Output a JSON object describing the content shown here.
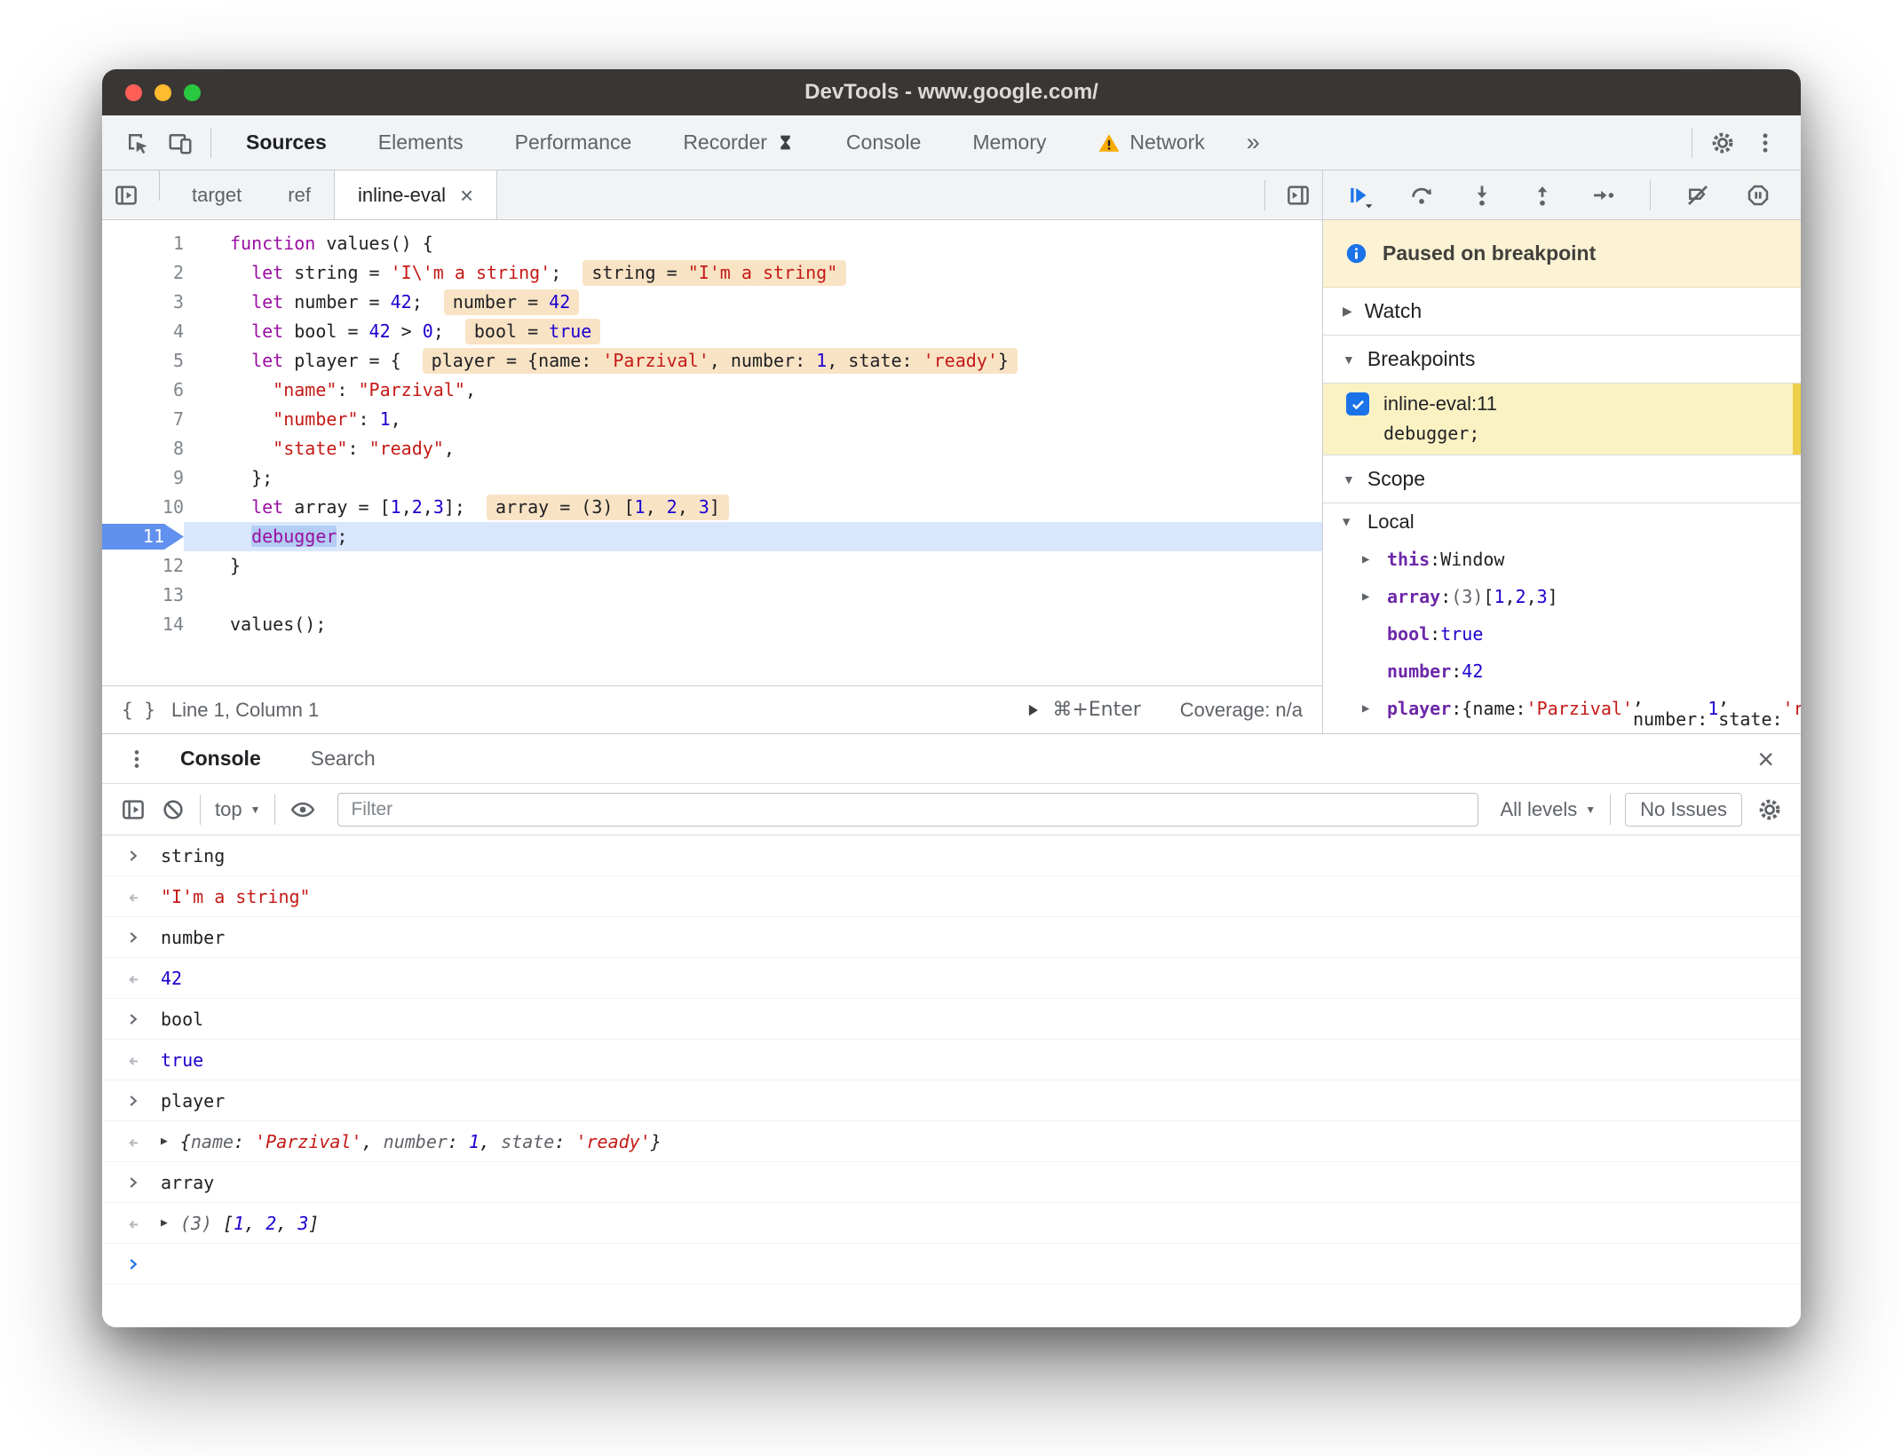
{
  "window": {
    "title": "DevTools - www.google.com/"
  },
  "toolbar": {
    "tabs": [
      {
        "label": "Sources",
        "active": true
      },
      {
        "label": "Elements"
      },
      {
        "label": "Performance"
      },
      {
        "label": "Recorder",
        "trailing_icon": "experiment-icon"
      },
      {
        "label": "Console"
      },
      {
        "label": "Memory"
      },
      {
        "label": "Network",
        "leading_icon": "warning-icon"
      }
    ],
    "overflow_label": "»"
  },
  "sources": {
    "file_tabs": [
      {
        "label": "target"
      },
      {
        "label": "ref"
      },
      {
        "label": "inline-eval",
        "active": true,
        "close_label": "×"
      }
    ],
    "status_bar": {
      "pretty_print_label": "{ }",
      "position": "Line 1, Column 1",
      "run_shortcut": "⌘+Enter",
      "coverage": "Coverage: n/a"
    },
    "lines": [
      {
        "n": 1,
        "code": [
          {
            "c": "k",
            "t": "function"
          },
          {
            "c": "p",
            "t": " values() {"
          }
        ]
      },
      {
        "n": 2,
        "code": [
          {
            "c": "p",
            "t": "  "
          },
          {
            "c": "k",
            "t": "let"
          },
          {
            "c": "p",
            "t": " string = "
          },
          {
            "c": "s",
            "t": "'I\\'m a string'"
          },
          {
            "c": "p",
            "t": ";"
          }
        ],
        "eval": [
          {
            "c": "p",
            "t": "string = "
          },
          {
            "c": "s",
            "t": "\"I'm a string\""
          }
        ]
      },
      {
        "n": 3,
        "code": [
          {
            "c": "p",
            "t": "  "
          },
          {
            "c": "k",
            "t": "let"
          },
          {
            "c": "p",
            "t": " number = "
          },
          {
            "c": "n",
            "t": "42"
          },
          {
            "c": "p",
            "t": ";"
          }
        ],
        "eval": [
          {
            "c": "p",
            "t": "number = "
          },
          {
            "c": "n",
            "t": "42"
          }
        ]
      },
      {
        "n": 4,
        "code": [
          {
            "c": "p",
            "t": "  "
          },
          {
            "c": "k",
            "t": "let"
          },
          {
            "c": "p",
            "t": " bool = "
          },
          {
            "c": "n",
            "t": "42"
          },
          {
            "c": "p",
            "t": " > "
          },
          {
            "c": "n",
            "t": "0"
          },
          {
            "c": "p",
            "t": ";"
          }
        ],
        "eval": [
          {
            "c": "p",
            "t": "bool = "
          },
          {
            "c": "n",
            "t": "true"
          }
        ]
      },
      {
        "n": 5,
        "code": [
          {
            "c": "p",
            "t": "  "
          },
          {
            "c": "k",
            "t": "let"
          },
          {
            "c": "p",
            "t": " player = {"
          }
        ],
        "eval": [
          {
            "c": "p",
            "t": "player = {name: "
          },
          {
            "c": "s",
            "t": "'Parzival'"
          },
          {
            "c": "p",
            "t": ", number: "
          },
          {
            "c": "n",
            "t": "1"
          },
          {
            "c": "p",
            "t": ", state: "
          },
          {
            "c": "s",
            "t": "'ready'"
          },
          {
            "c": "p",
            "t": "}"
          }
        ]
      },
      {
        "n": 6,
        "code": [
          {
            "c": "p",
            "t": "    "
          },
          {
            "c": "s",
            "t": "\"name\""
          },
          {
            "c": "p",
            "t": ": "
          },
          {
            "c": "s",
            "t": "\"Parzival\""
          },
          {
            "c": "p",
            "t": ","
          }
        ]
      },
      {
        "n": 7,
        "code": [
          {
            "c": "p",
            "t": "    "
          },
          {
            "c": "s",
            "t": "\"number\""
          },
          {
            "c": "p",
            "t": ": "
          },
          {
            "c": "n",
            "t": "1"
          },
          {
            "c": "p",
            "t": ","
          }
        ]
      },
      {
        "n": 8,
        "code": [
          {
            "c": "p",
            "t": "    "
          },
          {
            "c": "s",
            "t": "\"state\""
          },
          {
            "c": "p",
            "t": ": "
          },
          {
            "c": "s",
            "t": "\"ready\""
          },
          {
            "c": "p",
            "t": ","
          }
        ]
      },
      {
        "n": 9,
        "code": [
          {
            "c": "p",
            "t": "  };"
          }
        ]
      },
      {
        "n": 10,
        "code": [
          {
            "c": "p",
            "t": "  "
          },
          {
            "c": "k",
            "t": "let"
          },
          {
            "c": "p",
            "t": " array = ["
          },
          {
            "c": "n",
            "t": "1"
          },
          {
            "c": "p",
            "t": ","
          },
          {
            "c": "n",
            "t": "2"
          },
          {
            "c": "p",
            "t": ","
          },
          {
            "c": "n",
            "t": "3"
          },
          {
            "c": "p",
            "t": "];"
          }
        ],
        "eval": [
          {
            "c": "p",
            "t": "array = (3) ["
          },
          {
            "c": "n",
            "t": "1"
          },
          {
            "c": "p",
            "t": ", "
          },
          {
            "c": "n",
            "t": "2"
          },
          {
            "c": "p",
            "t": ", "
          },
          {
            "c": "n",
            "t": "3"
          },
          {
            "c": "p",
            "t": "]"
          }
        ]
      },
      {
        "n": 11,
        "exec": true,
        "code": [
          {
            "c": "p",
            "t": "  "
          },
          {
            "c": "ksel",
            "t": "debugger"
          },
          {
            "c": "p",
            "t": ";"
          }
        ]
      },
      {
        "n": 12,
        "code": [
          {
            "c": "p",
            "t": "}"
          }
        ]
      },
      {
        "n": 13,
        "code": [
          {
            "c": "p",
            "t": ""
          }
        ]
      },
      {
        "n": 14,
        "code": [
          {
            "c": "p",
            "t": "values();"
          }
        ]
      }
    ]
  },
  "debugger": {
    "paused_message": "Paused on breakpoint",
    "watch_arrow": "▶",
    "watch_label": "Watch",
    "breakpoints_arrow": "▼",
    "breakpoints_label": "Breakpoints",
    "scope_arrow": "▼",
    "scope_label": "Scope",
    "breakpoint": {
      "checked": true,
      "location": "inline-eval:11",
      "snippet": "debugger;"
    },
    "scope_rows": [
      {
        "kind": "group",
        "arrow": "▼",
        "label": "Local"
      },
      {
        "kind": "entry",
        "arrow": "▶",
        "tokens": [
          {
            "c": "v",
            "t": "this"
          },
          {
            "c": "p",
            "t": ": "
          },
          {
            "c": "p",
            "t": "Window"
          }
        ]
      },
      {
        "kind": "entry",
        "arrow": "▶",
        "tokens": [
          {
            "c": "v",
            "t": "array"
          },
          {
            "c": "p",
            "t": ": "
          },
          {
            "c": "g",
            "t": "(3) "
          },
          {
            "c": "p",
            "t": "["
          },
          {
            "c": "n",
            "t": "1"
          },
          {
            "c": "p",
            "t": ", "
          },
          {
            "c": "n",
            "t": "2"
          },
          {
            "c": "p",
            "t": ", "
          },
          {
            "c": "n",
            "t": "3"
          },
          {
            "c": "p",
            "t": "]"
          }
        ]
      },
      {
        "kind": "entry",
        "arrow": "",
        "tokens": [
          {
            "c": "v",
            "t": "bool"
          },
          {
            "c": "p",
            "t": ": "
          },
          {
            "c": "n",
            "t": "true"
          }
        ]
      },
      {
        "kind": "entry",
        "arrow": "",
        "tokens": [
          {
            "c": "v",
            "t": "number"
          },
          {
            "c": "p",
            "t": ": "
          },
          {
            "c": "n",
            "t": "42"
          }
        ]
      },
      {
        "kind": "entry",
        "arrow": "▶",
        "tokens": [
          {
            "c": "v",
            "t": "player"
          },
          {
            "c": "p",
            "t": ": "
          },
          {
            "c": "p",
            "t": "{name: "
          },
          {
            "c": "s",
            "t": "'Parzival'"
          },
          {
            "c": "p",
            "t": ", number: "
          },
          {
            "c": "n",
            "t": "1"
          },
          {
            "c": "p",
            "t": ", state: "
          },
          {
            "c": "s",
            "t": "'ready'"
          },
          {
            "c": "p",
            "t": "}"
          }
        ]
      }
    ]
  },
  "console": {
    "tabs": [
      {
        "label": "Console",
        "active": true
      },
      {
        "label": "Search"
      }
    ],
    "close_label": "×",
    "toolbar": {
      "context_label": "top",
      "filter_placeholder": "Filter",
      "levels_label": "All levels",
      "issues_label": "No Issues",
      "dropdown_caret": "▼"
    },
    "messages": [
      {
        "kind": "command",
        "tokens": [
          {
            "c": "p",
            "t": "string"
          }
        ]
      },
      {
        "kind": "result",
        "tokens": [
          {
            "c": "s",
            "t": "\"I'm a string\""
          }
        ]
      },
      {
        "kind": "command",
        "tokens": [
          {
            "c": "p",
            "t": "number"
          }
        ]
      },
      {
        "kind": "result",
        "tokens": [
          {
            "c": "n",
            "t": "42"
          }
        ]
      },
      {
        "kind": "command",
        "tokens": [
          {
            "c": "p",
            "t": "bool"
          }
        ]
      },
      {
        "kind": "result",
        "tokens": [
          {
            "c": "n",
            "t": "true"
          }
        ]
      },
      {
        "kind": "command",
        "tokens": [
          {
            "c": "p",
            "t": "player"
          }
        ]
      },
      {
        "kind": "result",
        "expandable": true,
        "italic": true,
        "tokens": [
          {
            "c": "p",
            "t": "{"
          },
          {
            "c": "g",
            "t": "name"
          },
          {
            "c": "p",
            "t": ": "
          },
          {
            "c": "s",
            "t": "'Parzival'"
          },
          {
            "c": "p",
            "t": ", "
          },
          {
            "c": "g",
            "t": "number"
          },
          {
            "c": "p",
            "t": ": "
          },
          {
            "c": "n",
            "t": "1"
          },
          {
            "c": "p",
            "t": ", "
          },
          {
            "c": "g",
            "t": "state"
          },
          {
            "c": "p",
            "t": ": "
          },
          {
            "c": "s",
            "t": "'ready'"
          },
          {
            "c": "p",
            "t": "}"
          }
        ]
      },
      {
        "kind": "command",
        "tokens": [
          {
            "c": "p",
            "t": "array"
          }
        ]
      },
      {
        "kind": "result",
        "expandable": true,
        "italic": true,
        "tokens": [
          {
            "c": "g",
            "t": "(3) "
          },
          {
            "c": "p",
            "t": "["
          },
          {
            "c": "n",
            "t": "1"
          },
          {
            "c": "p",
            "t": ", "
          },
          {
            "c": "n",
            "t": "2"
          },
          {
            "c": "p",
            "t": ", "
          },
          {
            "c": "n",
            "t": "3"
          },
          {
            "c": "p",
            "t": "]"
          }
        ]
      },
      {
        "kind": "prompt"
      }
    ]
  }
}
